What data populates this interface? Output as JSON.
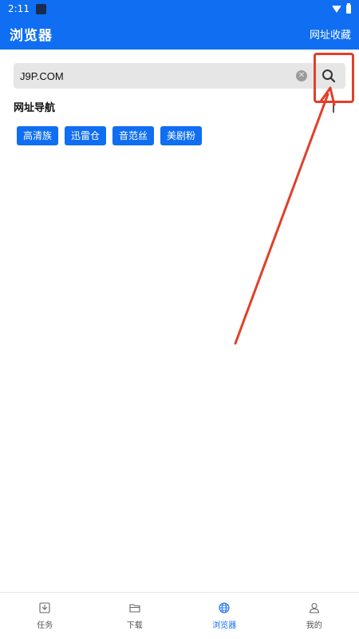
{
  "status_bar": {
    "time": "2:11"
  },
  "app_bar": {
    "title": "浏览器",
    "bookmarks_label": "网址收藏"
  },
  "search": {
    "value": "J9P.COM",
    "placeholder": ""
  },
  "navigation": {
    "title": "网址导航",
    "sites": [
      "高清族",
      "迅雷仓",
      "音范丝",
      "美剧粉"
    ]
  },
  "tabs": [
    {
      "label": "任务",
      "icon": "inbox-download-icon"
    },
    {
      "label": "下载",
      "icon": "folder-icon"
    },
    {
      "label": "浏览器",
      "icon": "globe-icon",
      "active": true
    },
    {
      "label": "我的",
      "icon": "person-icon"
    }
  ],
  "colors": {
    "primary": "#0f6ef2",
    "annotation": "#e0402a"
  }
}
